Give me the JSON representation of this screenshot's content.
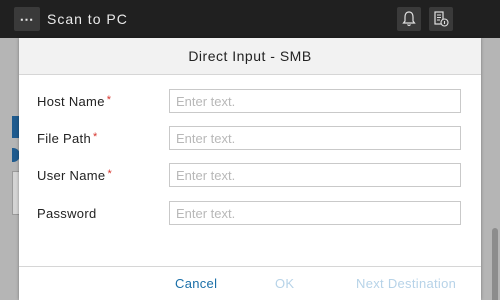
{
  "topbar": {
    "menu_glyph": "⋯",
    "title": "Scan to PC",
    "icons": [
      "bell-icon",
      "notice-icon"
    ]
  },
  "background": {
    "bg_color": "#b5b5b5",
    "accent": "#1f5b8e"
  },
  "dialog": {
    "title": "Direct Input - SMB",
    "fields": [
      {
        "label": "Host Name",
        "required": true,
        "required_mark": "*",
        "placeholder": "Enter text.",
        "value": ""
      },
      {
        "label": "File Path",
        "required": true,
        "required_mark": "*",
        "placeholder": "Enter text.",
        "value": ""
      },
      {
        "label": "User Name",
        "required": true,
        "required_mark": "*",
        "placeholder": "Enter text.",
        "value": ""
      },
      {
        "label": "Password",
        "required": false,
        "required_mark": "",
        "placeholder": "Enter text.",
        "value": ""
      }
    ],
    "buttons": {
      "cancel": "Cancel",
      "ok": "OK",
      "next": "Next Destination"
    },
    "colors": {
      "cancel": "#1a6fa8",
      "disabled": "#b7d3e8",
      "required": "#d6342c"
    }
  }
}
